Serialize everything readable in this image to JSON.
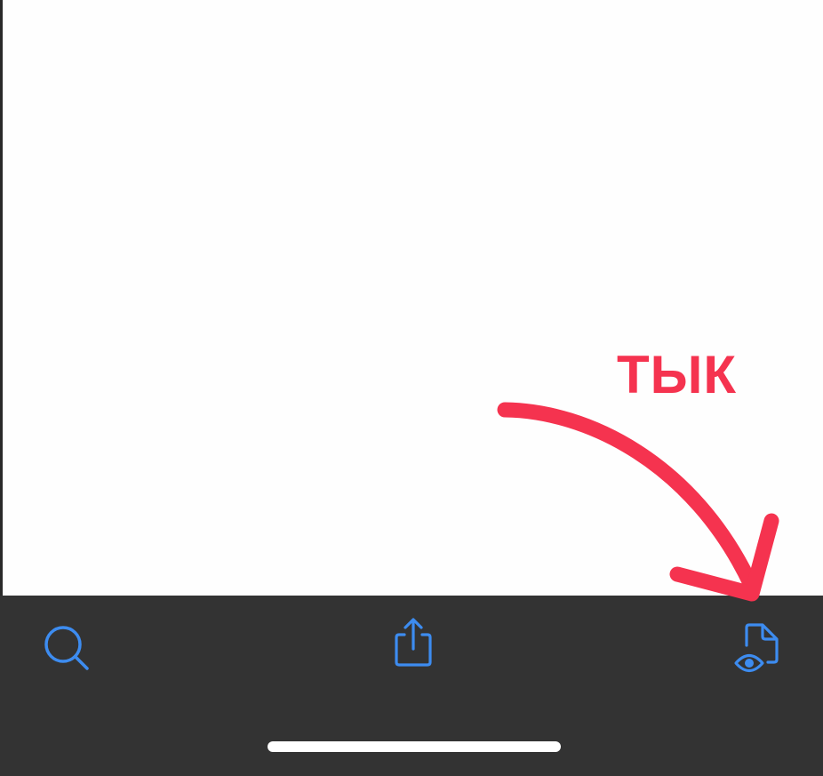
{
  "annotation": {
    "label": "ТЫК",
    "color": "#f5334f"
  },
  "toolbar": {
    "background": "#333333",
    "icon_color": "#3d8cf0",
    "buttons": [
      {
        "icon": "search-icon"
      },
      {
        "icon": "share-icon"
      },
      {
        "icon": "document-preview-icon"
      }
    ]
  }
}
